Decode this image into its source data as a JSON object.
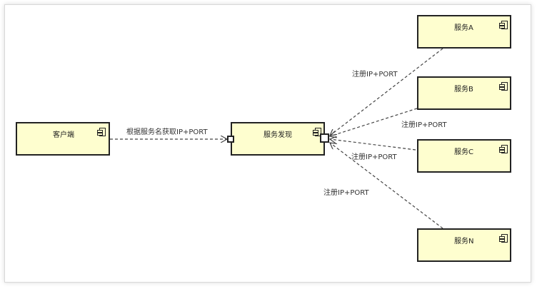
{
  "nodes": {
    "client": "客户端",
    "discovery": "服务发现",
    "service_a": "服务A",
    "service_b": "服务B",
    "service_c": "服务C",
    "service_n": "服务N"
  },
  "edges": {
    "client_to_discovery": "根据服务名获取IP+PORT",
    "register_a": "注册IP+PORT",
    "register_b": "注册IP+PORT",
    "register_c": "注册IP+PORT",
    "register_n": "注册IP+PORT"
  },
  "colors": {
    "node_fill": "#fefecf",
    "node_border": "#222222",
    "edge": "#444444"
  }
}
